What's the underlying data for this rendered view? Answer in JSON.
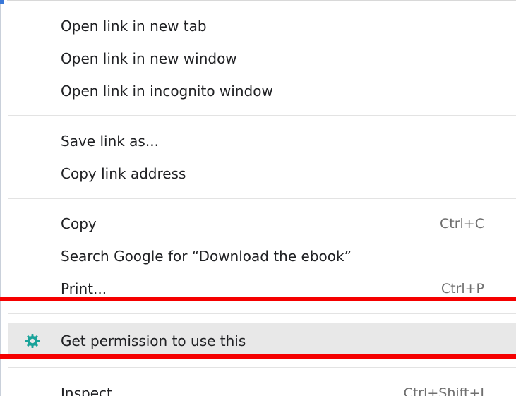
{
  "context_menu": {
    "groups": [
      [
        {
          "label": "Open link in new tab",
          "shortcut": ""
        },
        {
          "label": "Open link in new window",
          "shortcut": ""
        },
        {
          "label": "Open link in incognito window",
          "shortcut": ""
        }
      ],
      [
        {
          "label": "Save link as...",
          "shortcut": ""
        },
        {
          "label": "Copy link address",
          "shortcut": ""
        }
      ],
      [
        {
          "label": "Copy",
          "shortcut": "Ctrl+C"
        },
        {
          "label": "Search Google for “Download the ebook”",
          "shortcut": ""
        },
        {
          "label": "Print...",
          "shortcut": "Ctrl+P"
        }
      ],
      [
        {
          "label": "Get permission to use this",
          "shortcut": "",
          "icon": "gear-extension-icon",
          "highlighted": true
        }
      ],
      [
        {
          "label": "Inspect",
          "shortcut": "Ctrl+Shift+I"
        }
      ]
    ]
  },
  "colors": {
    "annotation_red": "#f50000",
    "highlight_bg": "#e8e8e8",
    "icon_teal": "#1aa39a",
    "text": "#202124",
    "shortcut_text": "#6f6f6f"
  }
}
